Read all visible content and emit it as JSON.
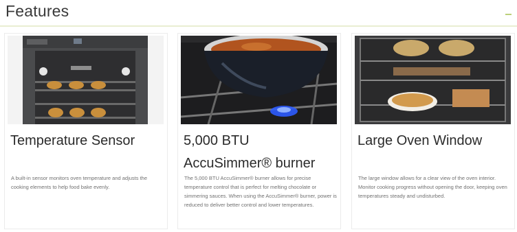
{
  "header": {
    "title": "Features"
  },
  "features": [
    {
      "title": "Temperature Sensor",
      "description": "A built-in sensor monitors oven temperature and adjusts the cooking elements to help food bake evenly."
    },
    {
      "title": "5,000 BTU AccuSimmer® burner",
      "description": "The 5,000 BTU AccuSimmer® burner allows for precise temperature control that is perfect for melting chocolate or simmering sauces. When using the AccuSimmer® burner, power is reduced to deliver better control and lower temperatures."
    },
    {
      "title": "Large Oven Window",
      "description": "The large window allows for a clear view of the oven interior. Monitor cooking progress without opening the door, keeping oven temperatures steady and undisturbed."
    }
  ]
}
